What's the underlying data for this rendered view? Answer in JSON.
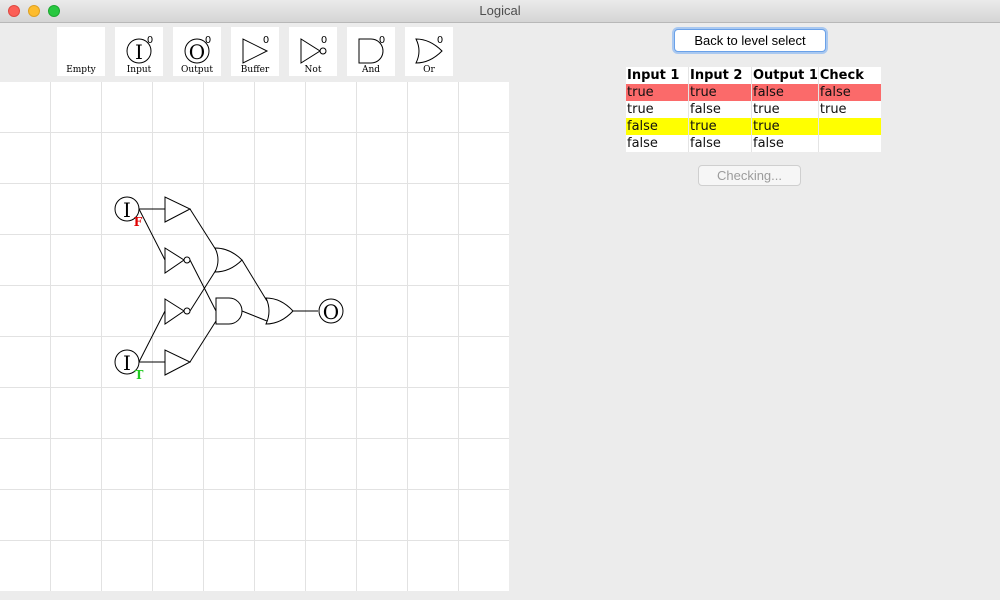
{
  "window": {
    "title": "Logical"
  },
  "palette": [
    {
      "label": "Empty",
      "icon": "empty-icon",
      "count": ""
    },
    {
      "label": "Input",
      "icon": "input-icon",
      "count": "0",
      "glyph": "I"
    },
    {
      "label": "Output",
      "icon": "output-icon",
      "count": "0",
      "glyph": "O"
    },
    {
      "label": "Buffer",
      "icon": "buffer-gate-icon",
      "count": "0"
    },
    {
      "label": "Not",
      "icon": "not-gate-icon",
      "count": "0"
    },
    {
      "label": "And",
      "icon": "and-gate-icon",
      "count": "0"
    },
    {
      "label": "Or",
      "icon": "or-gate-icon",
      "count": "0"
    }
  ],
  "circuit": {
    "input_glyph": "I",
    "output_glyph": "O",
    "input1_state": "F",
    "input2_state": "T",
    "colors": {
      "false_state": "#e00000",
      "true_state": "#22cc22",
      "grid": "#e2e2e2"
    }
  },
  "buttons": {
    "back": "Back to level select",
    "checking": "Checking..."
  },
  "truth_table": {
    "headers": [
      "Input 1",
      "Input 2",
      "Output 1",
      "Check"
    ],
    "rows": [
      {
        "cells": [
          "true",
          "true",
          "false",
          "false"
        ],
        "status": "red"
      },
      {
        "cells": [
          "true",
          "false",
          "true",
          "true"
        ],
        "status": "none"
      },
      {
        "cells": [
          "false",
          "true",
          "true",
          ""
        ],
        "status": "yellow"
      },
      {
        "cells": [
          "false",
          "false",
          "false",
          ""
        ],
        "status": "none"
      }
    ],
    "colors": {
      "red": "#fb6a6a",
      "yellow": "#ffff00"
    }
  }
}
